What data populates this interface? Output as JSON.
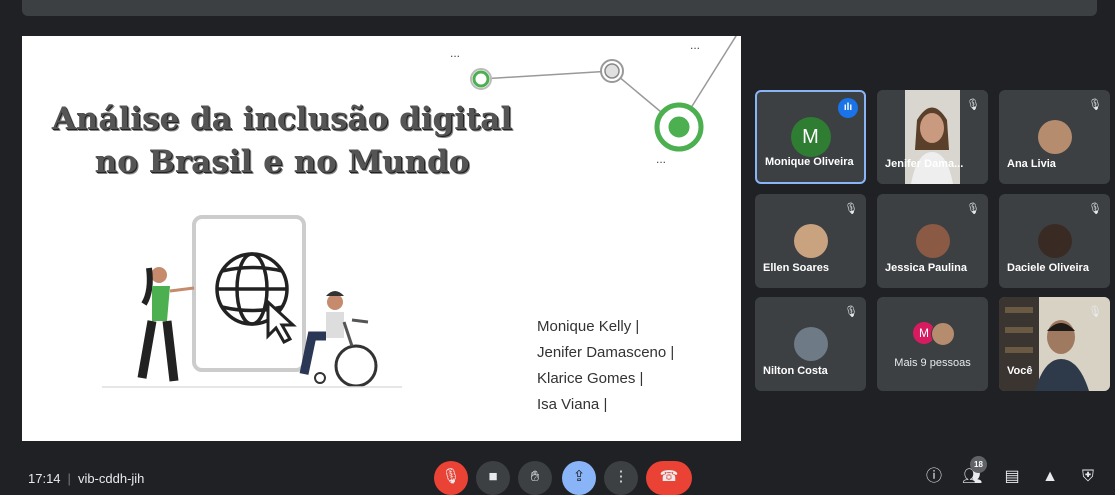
{
  "slide": {
    "title_line1": "Análise da inclusão digital",
    "title_line2": "no Brasil e no Mundo",
    "authors": [
      "Monique Kelly |",
      "Jenifer Damasceno |",
      "Klarice Gomes |",
      "Isa Viana |"
    ],
    "dots1": "...",
    "dots2": "...",
    "dots3": "..."
  },
  "participants": [
    {
      "name": "Monique Oliveira",
      "initial": "M",
      "speaking": true
    },
    {
      "name": "Jenifer Dama...",
      "muted": true
    },
    {
      "name": "Ana Livia",
      "muted": true
    },
    {
      "name": "Ellen Soares",
      "muted": true
    },
    {
      "name": "Jessica Paulina",
      "muted": true
    },
    {
      "name": "Daciele Oliveira",
      "muted": true
    },
    {
      "name": "Nilton Costa",
      "muted": true
    },
    {
      "more_label": "Mais 9 pessoas",
      "initial": "M"
    },
    {
      "name": "Você",
      "muted": true
    }
  ],
  "meeting": {
    "time": "17:14",
    "code": "vib-cddh-jih",
    "participant_count": "18"
  },
  "colors": {
    "background": "#202124",
    "tile": "#3c4043",
    "accent_blue": "#1a73e8",
    "end_call": "#ea4335",
    "slide_green": "#4caf50"
  }
}
